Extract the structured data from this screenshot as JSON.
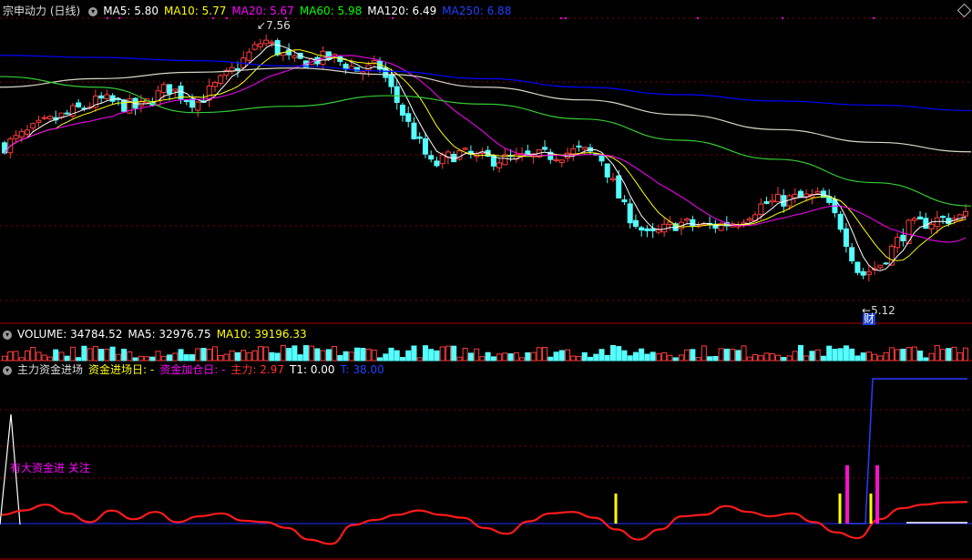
{
  "colors": {
    "bg": "#000000",
    "up": "#ff3b3b",
    "down": "#54ffff",
    "ma5": "#ffffff",
    "ma10": "#ffff00",
    "ma20": "#ff00ff",
    "ma60": "#00ff00",
    "ma120": "#ffffff",
    "ma250": "#0000ff",
    "grid": "#8a0000"
  },
  "price_panel": {
    "title": "宗申动力 (日线)",
    "indicators": [
      {
        "label": "MA5: 5.80",
        "color": "#ffffff"
      },
      {
        "label": "MA10: 5.77",
        "color": "#ffff00"
      },
      {
        "label": "MA20: 5.67",
        "color": "#ff00ff"
      },
      {
        "label": "MA60: 5.98",
        "color": "#00ff00"
      },
      {
        "label": "MA120: 6.49",
        "color": "#ffffff"
      },
      {
        "label": "MA250: 6.88",
        "color": "#2040ff"
      }
    ],
    "high_label": "7.56",
    "low_label": "5.12",
    "finance_badge": "财"
  },
  "volume_panel": {
    "indicators": [
      {
        "label": "VOLUME: 34784.52",
        "color": "#ffffff"
      },
      {
        "label": "MA5: 32976.75",
        "color": "#ffffff"
      },
      {
        "label": "MA10: 39196.33",
        "color": "#ffff00"
      }
    ]
  },
  "indicator_panel": {
    "title": "主力资金进场",
    "items": [
      {
        "label": "资金进场日: -",
        "color": "#ffff00"
      },
      {
        "label": "资金加仓日: -",
        "color": "#ff00ff"
      },
      {
        "label": "主力: 2.97",
        "color": "#ff3030"
      },
      {
        "label": "T1: 0.00",
        "color": "#ffffff"
      },
      {
        "label": "T: 38.00",
        "color": "#2040ff"
      }
    ],
    "annotation": "有大资金进 关注"
  },
  "chart_data": {
    "type": "candlestick",
    "title": "宗申动力 (日线)",
    "ylim": [
      4.9,
      7.75
    ],
    "ma_latest": {
      "MA5": 5.8,
      "MA10": 5.77,
      "MA20": 5.67,
      "MA60": 5.98,
      "MA120": 6.49,
      "MA250": 6.88
    },
    "ma_series": {
      "MA250": [
        7.4,
        7.38,
        7.35,
        7.3,
        7.25,
        7.18,
        7.1,
        7.03,
        6.97,
        6.93,
        6.88
      ],
      "MA120": [
        7.1,
        7.18,
        7.24,
        7.28,
        7.22,
        7.1,
        6.98,
        6.84,
        6.7,
        6.58,
        6.49
      ],
      "MA60": [
        7.2,
        7.1,
        6.86,
        6.92,
        7.02,
        6.94,
        6.8,
        6.6,
        6.42,
        6.2,
        5.98
      ]
    },
    "volume_latest": {
      "VOLUME": 34784.52,
      "MA5": 32976.75,
      "MA10": 39196.33
    },
    "indicator_latest": {
      "主力": 2.97,
      "T1": 0.0,
      "T": 38.0
    },
    "main_force": [
      1.2,
      1.8,
      2.6,
      1.4,
      0.2,
      1.8,
      0.6,
      1.6,
      0.2,
      1.0,
      1.4,
      0.4,
      0.2,
      -0.6,
      -2.2,
      -2.8,
      -0.2,
      0.5,
      1.2,
      1.8,
      1.2,
      0.8,
      -0.6,
      -1.4,
      0.3,
      1.4,
      1.6,
      0.8,
      -0.8,
      -2.2,
      -0.8,
      1.0,
      1.2,
      2.4,
      1.6,
      1.0,
      1.4,
      0.2,
      -1.2,
      -2.0,
      0.6,
      2.1,
      2.6,
      2.9,
      2.97
    ]
  }
}
